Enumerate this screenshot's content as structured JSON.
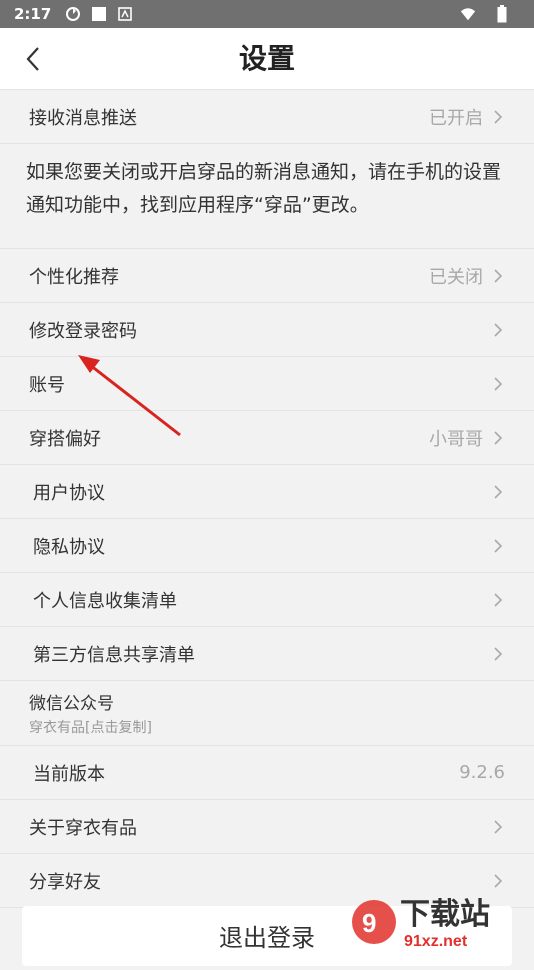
{
  "status_bar": {
    "time": "2:17"
  },
  "header": {
    "title": "设置"
  },
  "notifications": {
    "label": "接收消息推送",
    "value": "已开启"
  },
  "notice_text": "如果您要关闭或开启穿品的新消息通知，请在手机的设置 通知功能中，找到应用程序“穿品”更改。",
  "rows": [
    {
      "label": "个性化推荐",
      "value": "已关闭"
    },
    {
      "label": "修改登录密码",
      "value": ""
    },
    {
      "label": "账号",
      "value": ""
    },
    {
      "label": "穿搭偏好",
      "value": "小哥哥"
    },
    {
      "label": "用户协议",
      "value": ""
    },
    {
      "label": "隐私协议",
      "value": ""
    },
    {
      "label": "个人信息收集清单",
      "value": ""
    },
    {
      "label": "第三方信息共享清单",
      "value": ""
    }
  ],
  "wechat": {
    "label": "微信公众号",
    "sub": "穿衣有品[点击复制]"
  },
  "version": {
    "label": "当前版本",
    "value": "9.2.6"
  },
  "about": {
    "label": "关于穿衣有品"
  },
  "share": {
    "label": "分享好友"
  },
  "logout": {
    "label": "退出登录"
  },
  "watermark": {
    "big": "下载站",
    "small": "91xz.net"
  },
  "colors": {
    "accent_arrow": "#d8231f",
    "status_bar_bg": "#707070"
  }
}
